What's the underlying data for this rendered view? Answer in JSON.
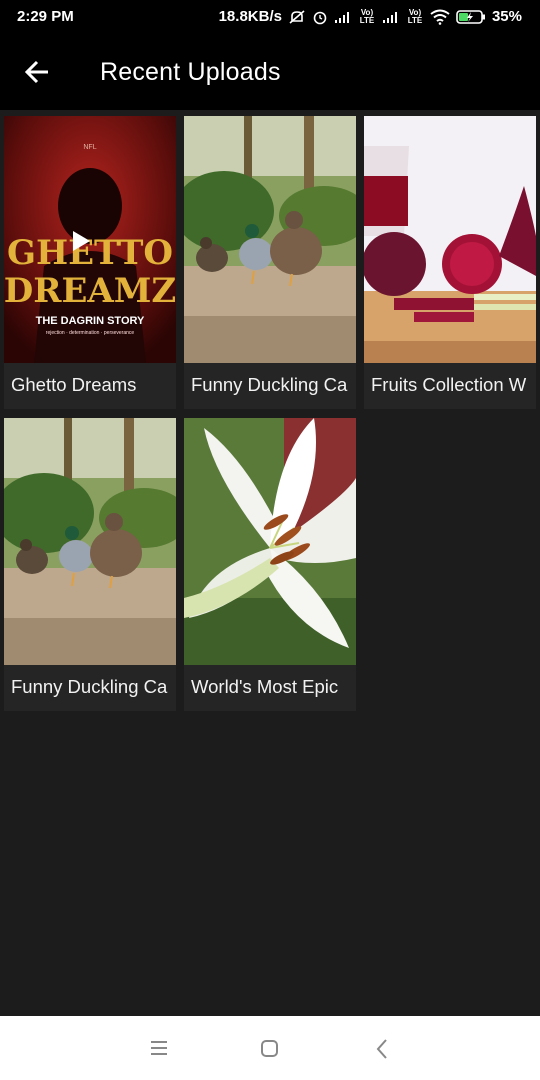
{
  "status": {
    "time": "2:29 PM",
    "speed": "18.8KB/s",
    "battery": "35%",
    "lte1": "Vo) LTE",
    "lte2": "Vo) LTE"
  },
  "header": {
    "title": "Recent Uploads",
    "back_icon": "arrow-left-icon"
  },
  "videos": [
    {
      "title": "Ghetto Dreams",
      "thumb_text_1": "GHETTO",
      "thumb_text_2": "DREAMZ",
      "thumb_text_3": "THE DAGRIN STORY",
      "thumb_text_4": "rejection · determination · perseverance",
      "thumb_badge": "NFL"
    },
    {
      "title": "Funny Duckling Ca"
    },
    {
      "title": "Fruits Collection W"
    },
    {
      "title": "Funny Duckling Ca"
    },
    {
      "title": "World's Most Epic"
    }
  ],
  "nav": {
    "menu_icon": "menu-icon",
    "home_icon": "home-square-icon",
    "back_icon": "back-chevron-icon"
  },
  "colors": {
    "background": "#1c1c1c",
    "card": "#252525",
    "bar": "#000000"
  }
}
